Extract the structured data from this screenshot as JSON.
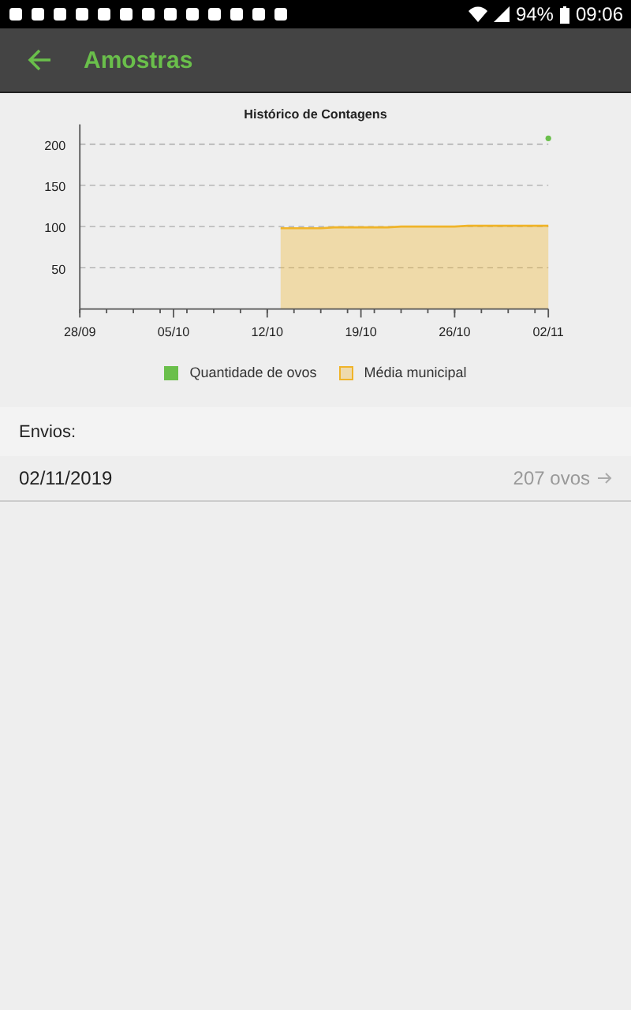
{
  "status_bar": {
    "battery": "94%",
    "time": "09:06"
  },
  "app_bar": {
    "title": "Amostras"
  },
  "chart": {
    "chart_data": {
      "type": "area",
      "title": "Histórico de Contagens",
      "categories": [
        "28/09",
        null,
        null,
        null,
        null,
        null,
        null,
        "05/10",
        null,
        null,
        null,
        null,
        null,
        null,
        "12/10",
        null,
        null,
        null,
        null,
        null,
        null,
        "19/10",
        null,
        null,
        null,
        null,
        null,
        null,
        "26/10",
        null,
        null,
        null,
        null,
        null,
        null,
        "02/11"
      ],
      "series": [
        {
          "name": "Quantidade de ovos",
          "color": "#6abf4b",
          "type": "scatter",
          "values": [
            null,
            null,
            null,
            null,
            null,
            null,
            null,
            null,
            null,
            null,
            null,
            null,
            null,
            null,
            null,
            null,
            null,
            null,
            null,
            null,
            null,
            null,
            null,
            null,
            null,
            null,
            null,
            null,
            null,
            null,
            null,
            null,
            null,
            null,
            null,
            207
          ]
        },
        {
          "name": "Média municipal",
          "color": "#f0b429",
          "type": "area",
          "values": [
            null,
            null,
            null,
            null,
            null,
            null,
            null,
            null,
            null,
            null,
            null,
            null,
            null,
            null,
            null,
            98,
            98,
            98,
            98,
            99,
            99,
            99,
            99,
            99,
            100,
            100,
            100,
            100,
            100,
            101,
            101,
            101,
            101,
            101,
            101,
            101
          ]
        }
      ],
      "ylim": [
        0,
        224
      ],
      "grid": true,
      "legend": "bottom",
      "yticks": [
        50,
        100,
        150,
        200
      ]
    }
  },
  "section_label": "Envios:",
  "shipments": [
    {
      "date": "02/11/2019",
      "count": "207 ovos"
    }
  ]
}
